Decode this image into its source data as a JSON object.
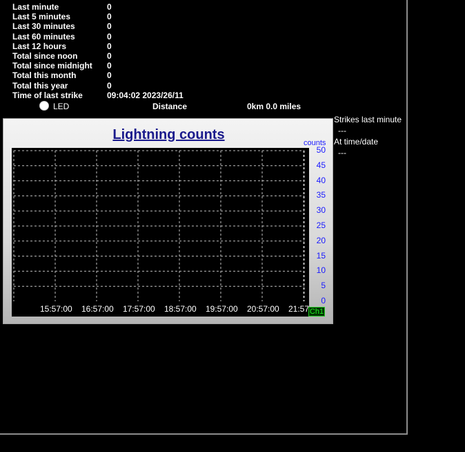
{
  "stats": [
    {
      "label": "Last minute",
      "value": "0"
    },
    {
      "label": "Last 5 minutes",
      "value": "0"
    },
    {
      "label": "Last 30 minutes",
      "value": "0"
    },
    {
      "label": "Last 60 minutes",
      "value": "0"
    },
    {
      "label": "Last 12 hours",
      "value": "0"
    },
    {
      "label": "Total since noon",
      "value": "0"
    },
    {
      "label": "Total since midnight",
      "value": "0"
    },
    {
      "label": "Total this month",
      "value": "0"
    },
    {
      "label": "Total this year",
      "value": "0"
    },
    {
      "label": "Time of last strike",
      "value": "09:04:02 2023/26/11"
    }
  ],
  "led": {
    "label": "LED"
  },
  "distance": {
    "label": "Distance",
    "value": "0km 0.0 miles"
  },
  "side": {
    "strikes_label": "Strikes last minute",
    "strikes_value": "---",
    "time_label": "At time/date",
    "time_value": "---"
  },
  "chart_data": {
    "type": "line",
    "title": "Lightning counts",
    "ylabel": "counts",
    "xlabel": "",
    "ylim": [
      0,
      50
    ],
    "y_ticks": [
      "50",
      "45",
      "40",
      "35",
      "30",
      "25",
      "20",
      "15",
      "10",
      "5",
      "0"
    ],
    "x_ticks": [
      "15:57:00",
      "16:57:00",
      "17:57:00",
      "18:57:00",
      "19:57:00",
      "20:57:00",
      "21:57"
    ],
    "grid": true,
    "channel_label": "Ch1",
    "series": []
  },
  "colors": {
    "background": "#000000",
    "chart_title": "#1a1a8c",
    "axis_labels": "#1a1aff",
    "grid": "#bfbfbf",
    "channel": "#22ee22"
  }
}
